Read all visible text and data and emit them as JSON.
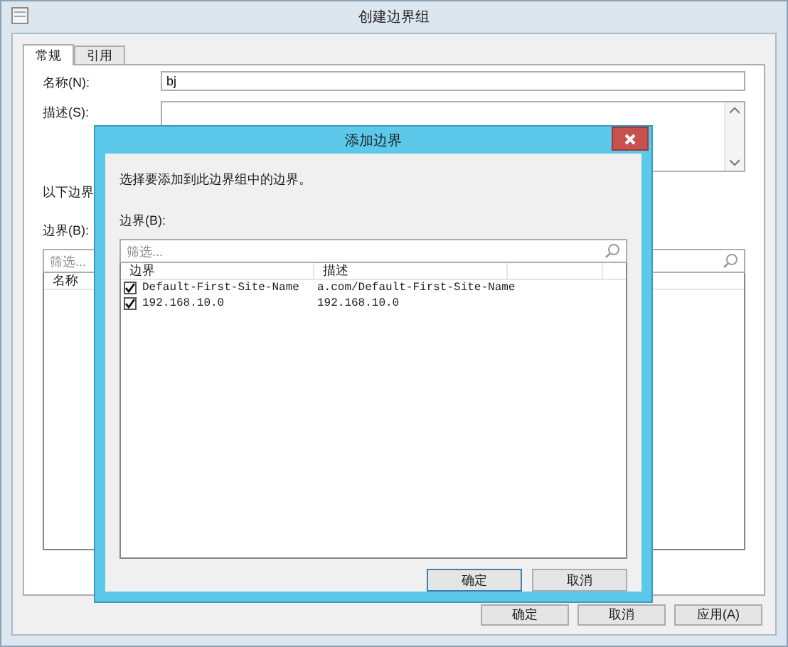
{
  "window": {
    "title": "创建边界组"
  },
  "tabs": [
    {
      "label": "常规",
      "selected": true
    },
    {
      "label": "引用",
      "selected": false
    }
  ],
  "name_field": {
    "label": "名称(N):",
    "value": "bj"
  },
  "description_field": {
    "label": "描述(S):"
  },
  "info_text": "以下边界",
  "boundaries": {
    "label": "边界(B):",
    "filter": {
      "placeholder": "筛选..."
    },
    "columns": [
      "名称"
    ]
  },
  "buttons": [
    "确定",
    "取消",
    "应用(A)"
  ],
  "dialog": {
    "title": "添加边界",
    "prompt": "选择要添加到此边界组中的边界。",
    "list_label": "边界(B):",
    "filter": {
      "placeholder": "筛选..."
    },
    "columns": [
      "边界",
      "描述"
    ],
    "rows": [
      {
        "checked": true,
        "cells": [
          "Default-First-Site-Name",
          "a.com/Default-First-Site-Name"
        ]
      },
      {
        "checked": true,
        "cells": [
          "192.168.10.0",
          "192.168.10.0"
        ]
      }
    ],
    "buttons": [
      "确定",
      "取消"
    ]
  }
}
